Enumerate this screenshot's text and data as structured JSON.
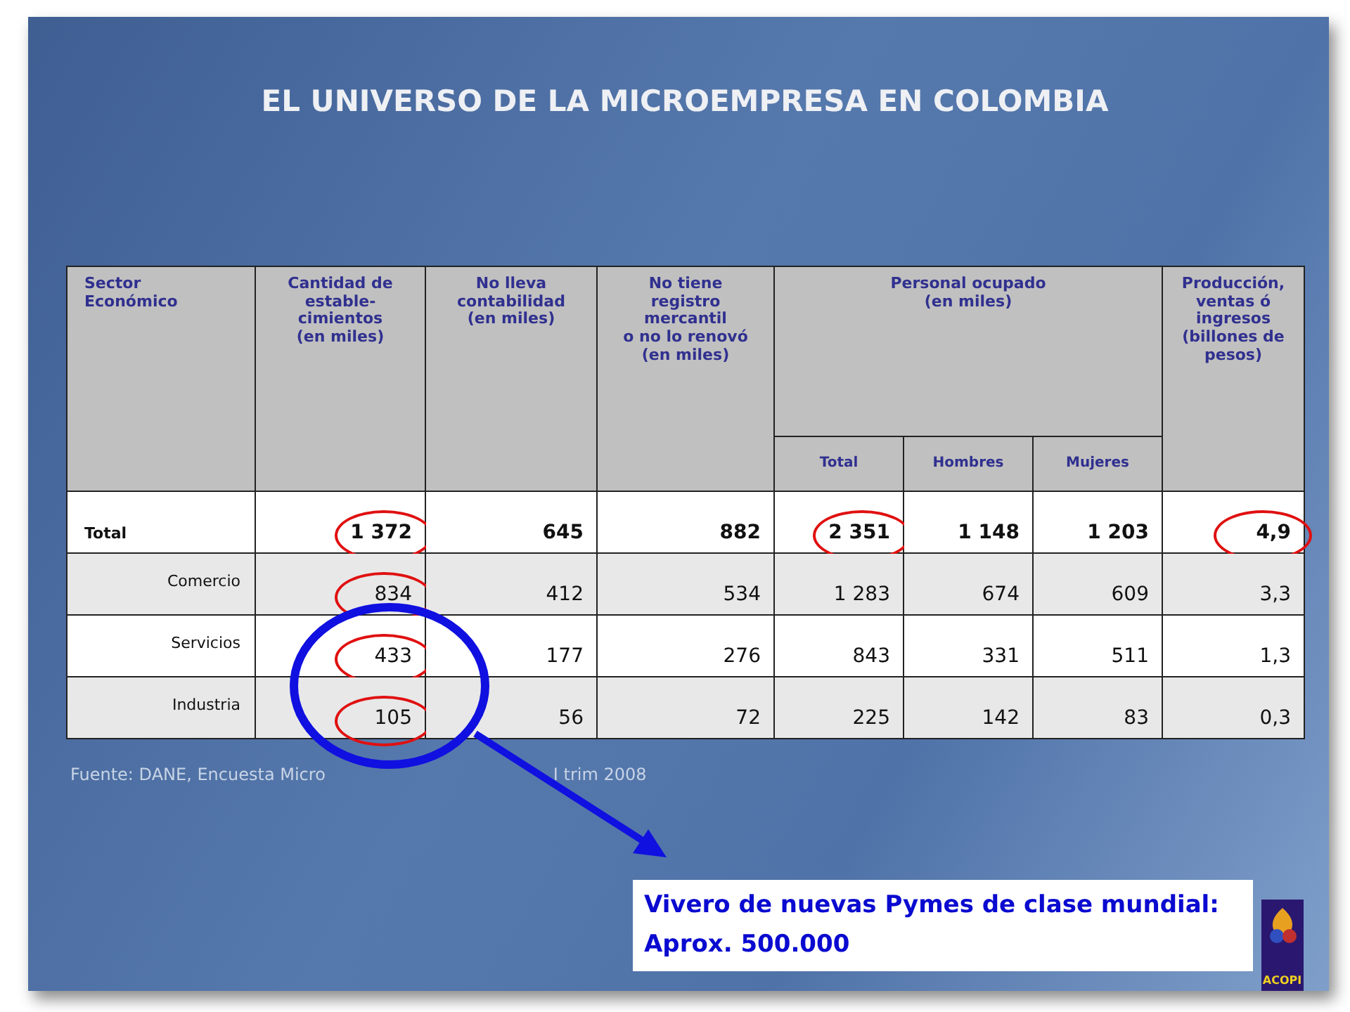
{
  "title": "EL UNIVERSO DE LA MICROEMPRESA EN COLOMBIA",
  "table": {
    "columns": [
      {
        "label": "Sector\nEconómico"
      },
      {
        "label": "Cantidad de\nestable-\ncimientos\n(en miles)"
      },
      {
        "label": "No lleva\ncontabilidad\n(en miles)"
      },
      {
        "label": "No tiene\nregistro\nmercantil\no no lo renovó\n(en miles)"
      },
      {
        "label": "Personal ocupado\n(en miles)",
        "colspan": 3,
        "subcolumns": [
          "Total",
          "Hombres",
          "Mujeres"
        ]
      },
      {
        "label": "Producción,\nventas ó\ningresos\n(billones de\npesos)"
      }
    ],
    "rows": [
      {
        "kind": "total",
        "cells": [
          {
            "value": "Total",
            "circled": false
          },
          {
            "value": "1 372",
            "circled": true
          },
          {
            "value": "645",
            "circled": false
          },
          {
            "value": "882",
            "circled": false
          },
          {
            "value": "2 351",
            "circled": true
          },
          {
            "value": "1 148",
            "circled": false
          },
          {
            "value": "1 203",
            "circled": false
          },
          {
            "value": "4,9",
            "circled": true
          }
        ]
      },
      {
        "kind": "sector",
        "cells": [
          {
            "value": "Comercio",
            "circled": false
          },
          {
            "value": "834",
            "circled": true
          },
          {
            "value": "412",
            "circled": false
          },
          {
            "value": "534",
            "circled": false
          },
          {
            "value": "1 283",
            "circled": false
          },
          {
            "value": "674",
            "circled": false
          },
          {
            "value": "609",
            "circled": false
          },
          {
            "value": "3,3",
            "circled": false
          }
        ]
      },
      {
        "kind": "sector",
        "cells": [
          {
            "value": "Servicios",
            "circled": false
          },
          {
            "value": "433",
            "circled": true
          },
          {
            "value": "177",
            "circled": false
          },
          {
            "value": "276",
            "circled": false
          },
          {
            "value": "843",
            "circled": false
          },
          {
            "value": "331",
            "circled": false
          },
          {
            "value": "511",
            "circled": false
          },
          {
            "value": "1,3",
            "circled": false
          }
        ]
      },
      {
        "kind": "sector",
        "cells": [
          {
            "value": "Industria",
            "circled": false
          },
          {
            "value": "105",
            "circled": true
          },
          {
            "value": "56",
            "circled": false
          },
          {
            "value": "72",
            "circled": false
          },
          {
            "value": "225",
            "circled": false
          },
          {
            "value": "142",
            "circled": false
          },
          {
            "value": "83",
            "circled": false
          },
          {
            "value": "0,3",
            "circled": false
          }
        ]
      }
    ]
  },
  "source": [
    "Fuente: DANE, Encuesta Micro",
    "I trim 2008"
  ],
  "callout": [
    "Vivero de nuevas Pymes de clase mundial:",
    "Aprox. 500.000"
  ],
  "logo": {
    "text": "ACOPI"
  }
}
